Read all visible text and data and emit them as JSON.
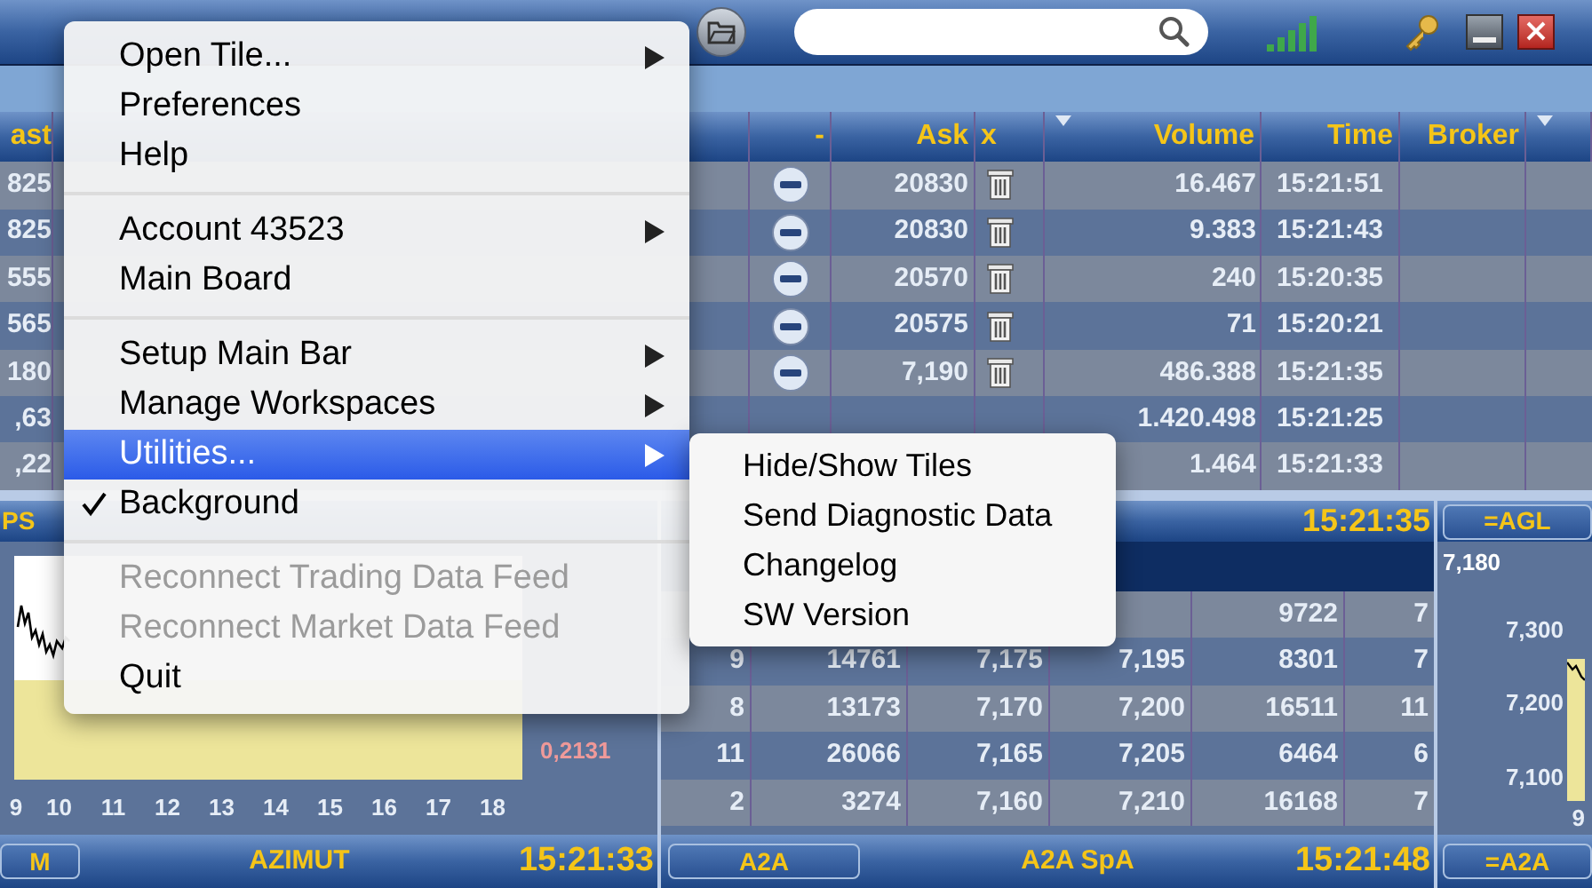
{
  "quotes_table": {
    "columns": [
      {
        "label": "ast",
        "sort_indicator": false
      },
      {
        "label": "-",
        "sort_indicator": false
      },
      {
        "label": "Ask",
        "sort_indicator": false
      },
      {
        "label": "x",
        "sort_indicator": false
      },
      {
        "label": "Volume",
        "sort_indicator": true
      },
      {
        "label": "Time",
        "sort_indicator": false
      },
      {
        "label": "Broker",
        "sort_indicator": false
      },
      {
        "sort_indicator": true
      }
    ],
    "rows": [
      {
        "last": "825",
        "ask": "20830",
        "volume": "16.467",
        "time": "15:21:51"
      },
      {
        "last": "825",
        "ask": "20830",
        "volume": "9.383",
        "time": "15:21:43"
      },
      {
        "last": "555",
        "ask": "20570",
        "volume": "240",
        "time": "15:20:35"
      },
      {
        "last": "565",
        "ask": "20575",
        "volume": "71",
        "time": "15:20:21"
      },
      {
        "last": "180",
        "ask": "7,190",
        "volume": "486.388",
        "time": "15:21:35"
      },
      {
        "last": ",63",
        "ask": null,
        "volume": "1.420.498",
        "time": "15:21:25"
      },
      {
        "last": ",22",
        "ask": null,
        "volume": "1.464",
        "time": "15:21:33"
      }
    ]
  },
  "left_panel": {
    "title": "PS",
    "chart": {
      "x_ticks": [
        "9",
        "10",
        "11",
        "12",
        "13",
        "14",
        "15",
        "16",
        "17",
        "18"
      ]
    },
    "price": "0,2131",
    "footer": {
      "button": "M",
      "name": "AZIMUT",
      "time": "15:21:33"
    }
  },
  "middle_panel": {
    "time": "15:21:35",
    "rows": [
      [
        null,
        null,
        null,
        null,
        "9722",
        "7"
      ],
      [
        "9",
        "14761",
        "7,175",
        "7,195",
        "8301",
        "7"
      ],
      [
        "8",
        "13173",
        "7,170",
        "7,200",
        "16511",
        "11"
      ],
      [
        "11",
        "26066",
        "7,165",
        "7,205",
        "6464",
        "6"
      ],
      [
        "2",
        "3274",
        "7,160",
        "7,210",
        "16168",
        "7"
      ]
    ],
    "footer": {
      "button": "A2A",
      "name": "A2A SpA",
      "time": "15:21:48"
    }
  },
  "right_panel": {
    "button": "=AGL",
    "price": "7,180",
    "chart": {
      "y_ticks": [
        "7,300",
        "7,200",
        "7,100"
      ],
      "x_ticks": [
        "9"
      ]
    },
    "footer": {
      "button": "=A2A"
    }
  },
  "menu": {
    "items": [
      {
        "kind": "item",
        "label": "Open Tile...",
        "has_submenu": true,
        "selected": false,
        "checked": false,
        "disabled": false
      },
      {
        "kind": "item",
        "label": "Preferences",
        "has_submenu": false,
        "selected": false,
        "checked": false,
        "disabled": false
      },
      {
        "kind": "item",
        "label": "Help",
        "has_submenu": false,
        "selected": false,
        "checked": false,
        "disabled": false
      },
      {
        "kind": "separator"
      },
      {
        "kind": "item",
        "label": "Account 43523",
        "has_submenu": true,
        "selected": false,
        "checked": false,
        "disabled": false
      },
      {
        "kind": "item",
        "label": "Main Board",
        "has_submenu": false,
        "selected": false,
        "checked": false,
        "disabled": false
      },
      {
        "kind": "separator"
      },
      {
        "kind": "item",
        "label": "Setup Main Bar",
        "has_submenu": true,
        "selected": false,
        "checked": false,
        "disabled": false
      },
      {
        "kind": "item",
        "label": "Manage Workspaces",
        "has_submenu": true,
        "selected": false,
        "checked": false,
        "disabled": false
      },
      {
        "kind": "item",
        "label": "Utilities...",
        "has_submenu": true,
        "selected": true,
        "checked": false,
        "disabled": false
      },
      {
        "kind": "item",
        "label": "Background",
        "has_submenu": false,
        "selected": false,
        "checked": true,
        "disabled": false
      },
      {
        "kind": "separator"
      },
      {
        "kind": "item",
        "label": "Reconnect Trading Data Feed",
        "has_submenu": false,
        "selected": false,
        "checked": false,
        "disabled": true
      },
      {
        "kind": "item",
        "label": "Reconnect Market Data Feed",
        "has_submenu": false,
        "selected": false,
        "checked": false,
        "disabled": true
      },
      {
        "kind": "item",
        "label": "Quit",
        "has_submenu": false,
        "selected": false,
        "checked": false,
        "disabled": false
      }
    ]
  },
  "submenu": {
    "items": [
      {
        "label": "Hide/Show Tiles"
      },
      {
        "label": "Send Diagnostic Data"
      },
      {
        "label": "Changelog"
      },
      {
        "label": "SW Version"
      }
    ]
  }
}
